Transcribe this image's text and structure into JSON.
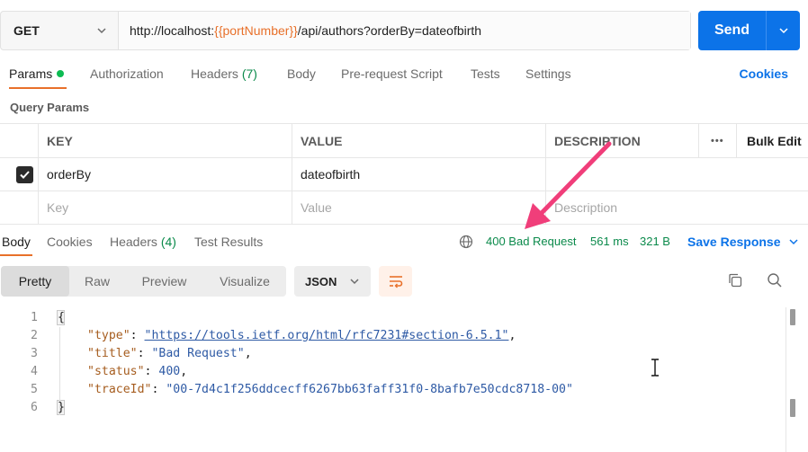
{
  "request": {
    "method": "GET",
    "url_prefix": "http://localhost:",
    "url_variable": "{{portNumber}}",
    "url_suffix": "/api/authors?orderBy=dateofbirth",
    "send_label": "Send"
  },
  "request_tabs": {
    "params": "Params",
    "authorization": "Authorization",
    "headers": "Headers",
    "headers_count": "(7)",
    "body": "Body",
    "pre_request_script": "Pre-request Script",
    "tests": "Tests",
    "settings": "Settings",
    "cookies": "Cookies"
  },
  "query_params": {
    "title": "Query Params",
    "columns": {
      "key": "KEY",
      "value": "VALUE",
      "description": "DESCRIPTION",
      "bulk_edit": "Bulk Edit",
      "more": "•••"
    },
    "rows": [
      {
        "checked": true,
        "key": "orderBy",
        "value": "dateofbirth",
        "description": ""
      }
    ],
    "placeholders": {
      "key": "Key",
      "value": "Value",
      "description": "Description"
    }
  },
  "response_tabs": {
    "body": "Body",
    "cookies": "Cookies",
    "headers": "Headers",
    "headers_count": "(4)",
    "test_results": "Test Results"
  },
  "response_status": {
    "status": "400 Bad Request",
    "time": "561 ms",
    "size": "321 B",
    "save_label": "Save Response",
    "status_color": "#0b8a4b"
  },
  "view_options": {
    "modes": [
      "Pretty",
      "Raw",
      "Preview",
      "Visualize"
    ],
    "active_mode": "Pretty",
    "format": "JSON"
  },
  "response_body": {
    "line_numbers": [
      "1",
      "2",
      "3",
      "4",
      "5",
      "6"
    ],
    "open_brace": "{",
    "close_brace": "}",
    "fields": [
      {
        "key": "\"type\"",
        "value": "\"https://tools.ietf.org/html/rfc7231#section-6.5.1\"",
        "comma": ","
      },
      {
        "key": "\"title\"",
        "value": "\"Bad Request\"",
        "comma": ","
      },
      {
        "key": "\"status\"",
        "value": "400",
        "comma": ","
      },
      {
        "key": "\"traceId\"",
        "value": "\"00-7d4c1f256ddcecff6267bb63faff31f0-8bafb7e50cdc8718-00\"",
        "comma": ""
      }
    ]
  },
  "colors": {
    "accent_blue": "#0c73e8",
    "tab_underline": "#e8702a",
    "annotation_arrow": "#f03e7a"
  }
}
